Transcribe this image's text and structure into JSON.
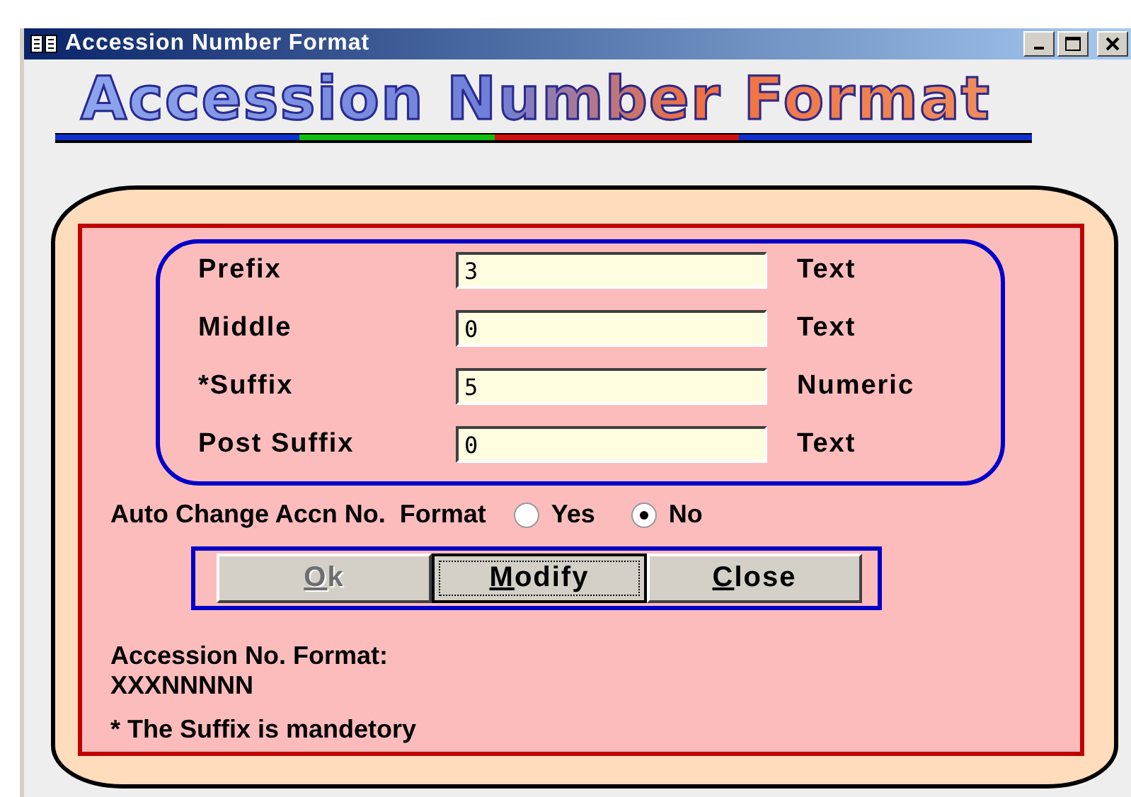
{
  "window": {
    "title": "Accession Number Format"
  },
  "banner": "Accession Number Format",
  "fields": [
    {
      "label": "Prefix",
      "value": "3",
      "type": "Text"
    },
    {
      "label": "Middle",
      "value": "0",
      "type": "Text"
    },
    {
      "label": "*Suffix",
      "value": "5",
      "type": "Numeric"
    },
    {
      "label": "Post Suffix",
      "value": "0",
      "type": "Text"
    }
  ],
  "auto_change": {
    "label": "Auto Change Accn No.  Format",
    "options": [
      {
        "label": "Yes",
        "selected": false
      },
      {
        "label": "No",
        "selected": true
      }
    ]
  },
  "buttons": [
    {
      "mnemonic": "O",
      "rest": "k",
      "disabled": true,
      "focused": false
    },
    {
      "mnemonic": "M",
      "rest": "odify",
      "disabled": false,
      "focused": true
    },
    {
      "mnemonic": "C",
      "rest": "lose",
      "disabled": false,
      "focused": false
    }
  ],
  "format_label": "Accession No. Format:",
  "format_value": "XXXNNNNN",
  "footnote": "* The Suffix is mandetory"
}
